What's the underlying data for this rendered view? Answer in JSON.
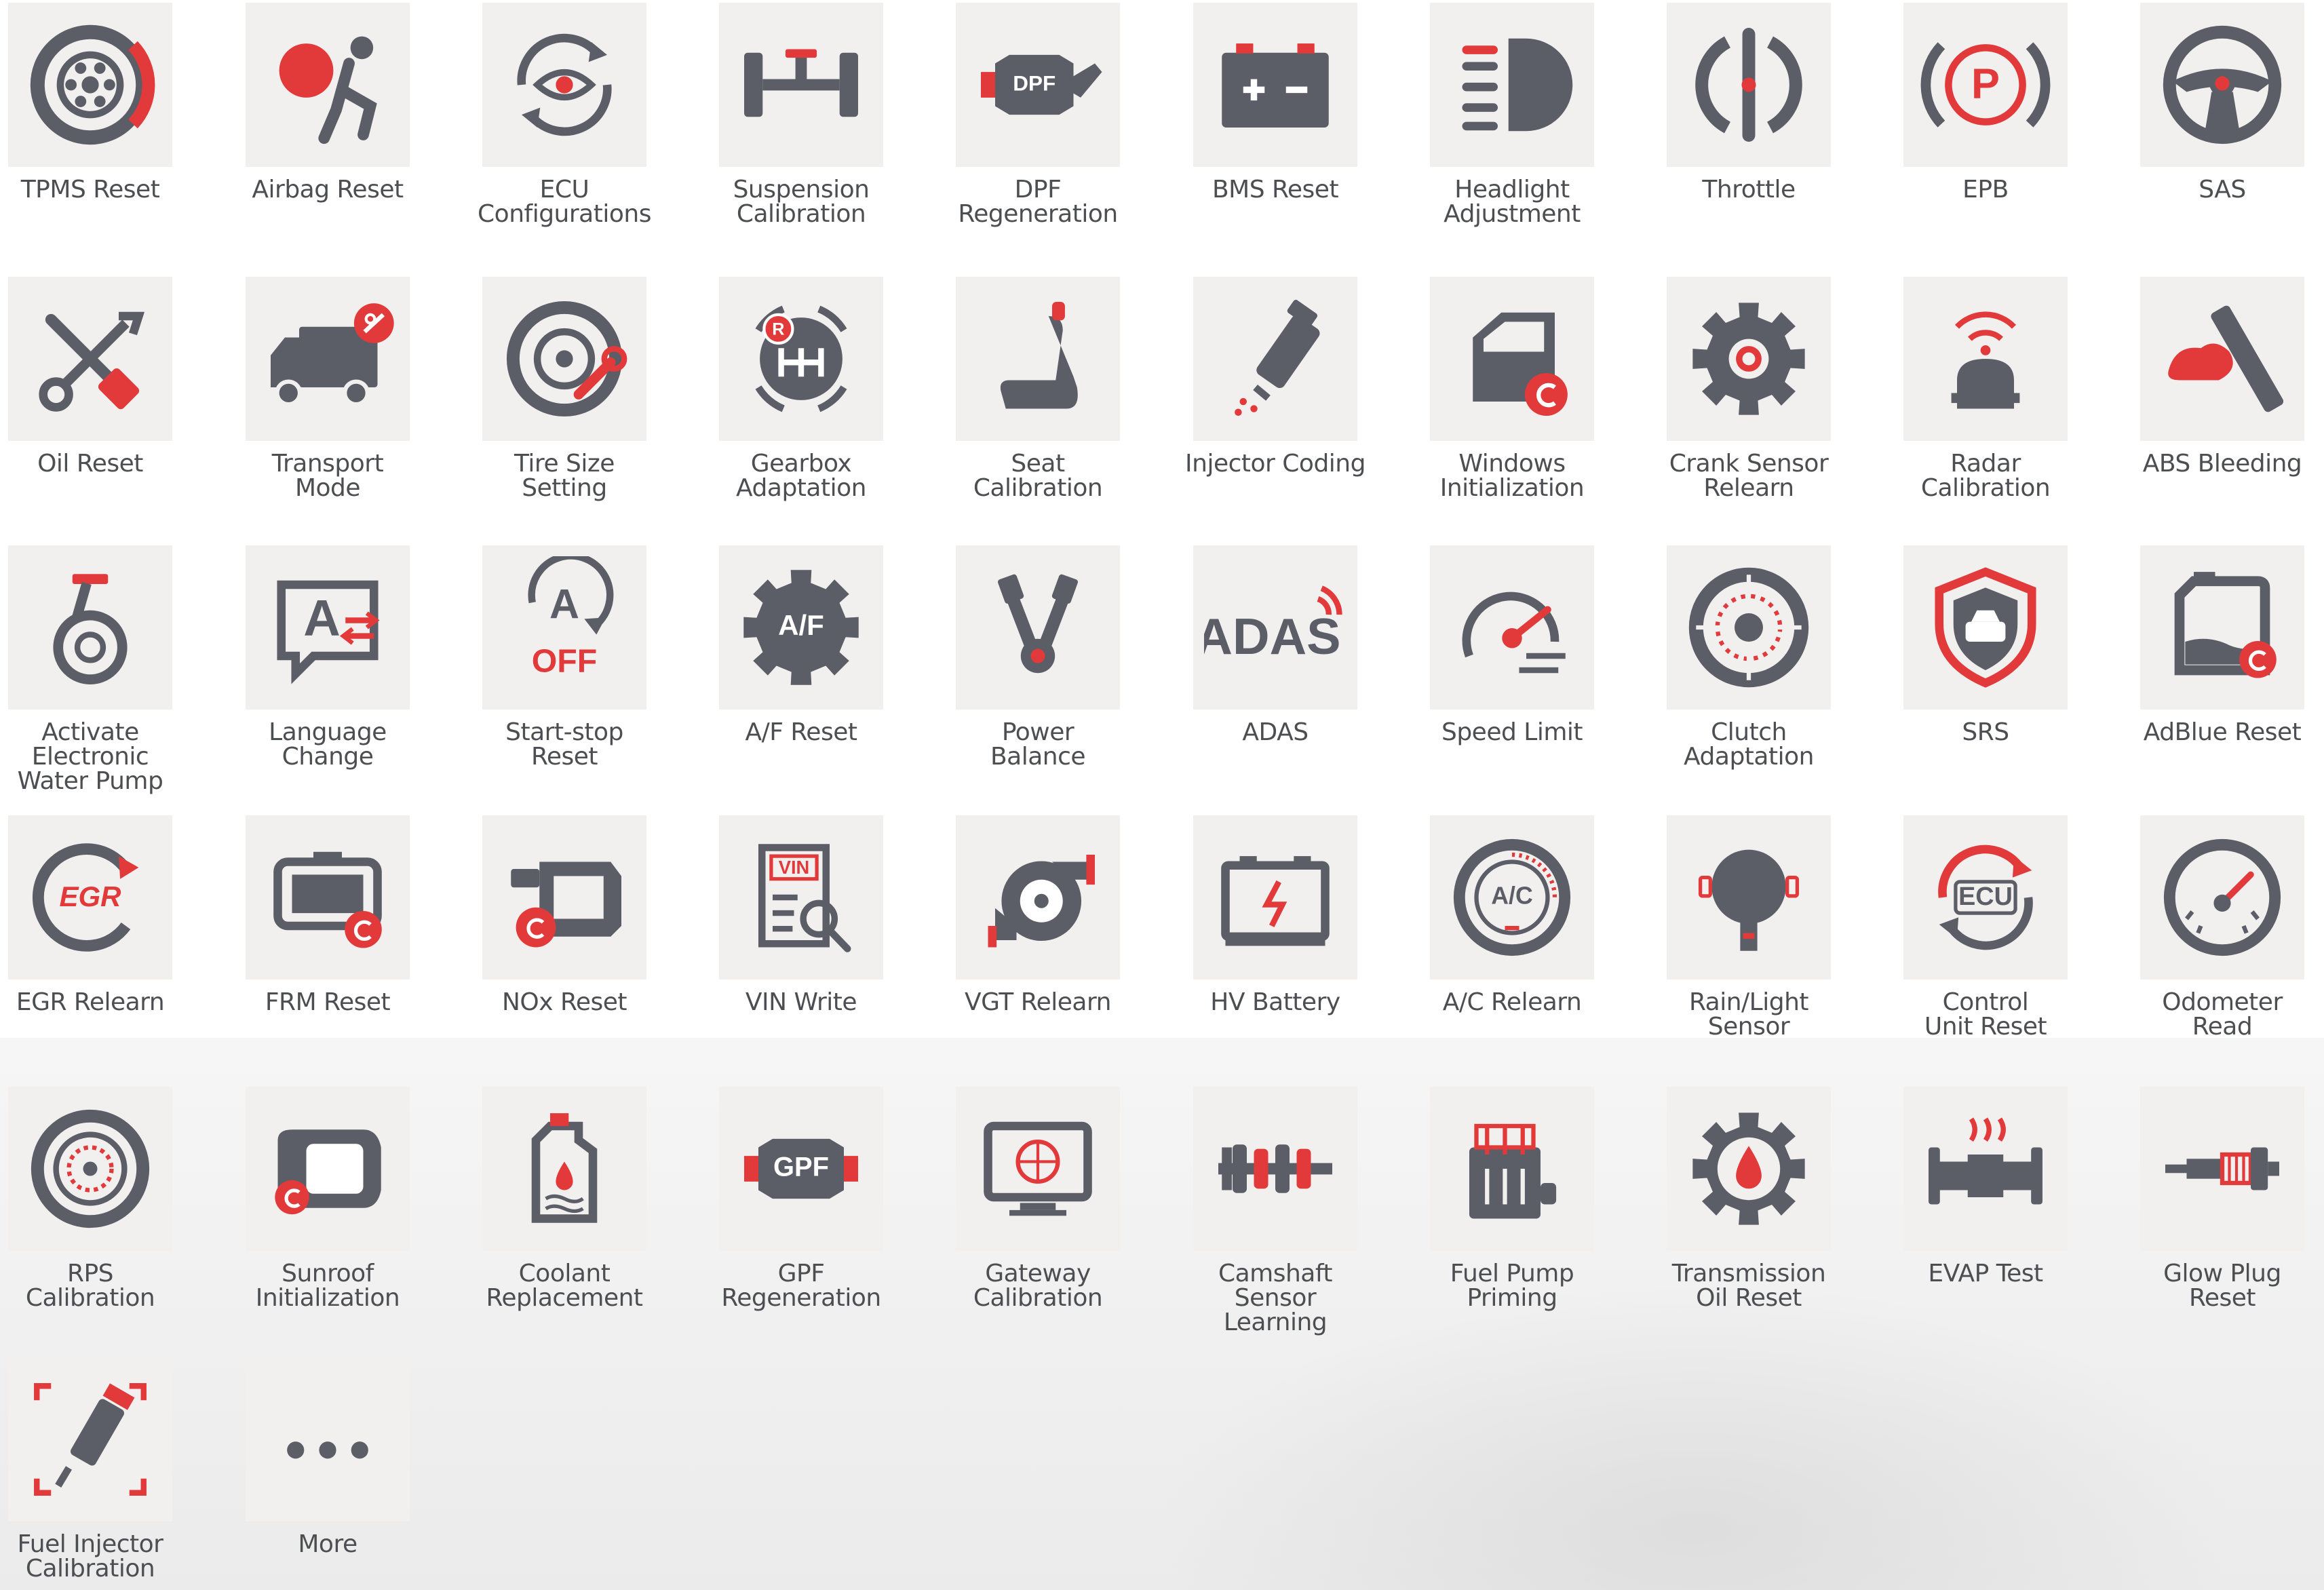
{
  "colors": {
    "icon_gray": "#5b5e66",
    "accent_red": "#e23a3a",
    "tile_bg": "#f2efef",
    "label": "#4d4e52"
  },
  "functions": [
    {
      "icon": "tire-icon",
      "label_lines": [
        "TPMS Reset"
      ]
    },
    {
      "icon": "airbag-icon",
      "label_lines": [
        "Airbag Reset"
      ]
    },
    {
      "icon": "ecu-eye-icon",
      "label_lines": [
        "ECU",
        "Configurations"
      ]
    },
    {
      "icon": "suspension-icon",
      "label_lines": [
        "Suspension",
        "Calibration"
      ]
    },
    {
      "icon": "dpf-icon",
      "label_lines": [
        "DPF",
        "Regeneration"
      ],
      "icon_text": "DPF"
    },
    {
      "icon": "battery-icon",
      "label_lines": [
        "BMS Reset"
      ]
    },
    {
      "icon": "headlight-icon",
      "label_lines": [
        "Headlight",
        "Adjustment"
      ]
    },
    {
      "icon": "throttle-icon",
      "label_lines": [
        "Throttle"
      ]
    },
    {
      "icon": "parking-brake-icon",
      "label_lines": [
        "EPB"
      ],
      "icon_text": "P"
    },
    {
      "icon": "steering-wheel-icon",
      "label_lines": [
        "SAS"
      ]
    },
    {
      "icon": "wrench-screwdriver-icon",
      "label_lines": [
        "Oil Reset"
      ]
    },
    {
      "icon": "truck-icon",
      "label_lines": [
        "Transport Mode"
      ]
    },
    {
      "icon": "tire-wrench-icon",
      "label_lines": [
        "Tire Size",
        "Setting"
      ]
    },
    {
      "icon": "gear-shift-icon",
      "label_lines": [
        "Gearbox",
        "Adaptation"
      ],
      "icon_text": "R"
    },
    {
      "icon": "seat-icon",
      "label_lines": [
        "Seat Calibration"
      ]
    },
    {
      "icon": "injector-icon",
      "label_lines": [
        "Injector Coding"
      ]
    },
    {
      "icon": "car-door-icon",
      "label_lines": [
        "Windows",
        "Initialization"
      ]
    },
    {
      "icon": "cog-icon",
      "label_lines": [
        "Crank Sensor",
        "Relearn"
      ]
    },
    {
      "icon": "radar-icon",
      "label_lines": [
        "Radar",
        "Calibration"
      ]
    },
    {
      "icon": "abs-bleeding-icon",
      "label_lines": [
        "ABS Bleeding"
      ]
    },
    {
      "icon": "water-pump-icon",
      "label_lines": [
        "Activate",
        "Electronic",
        "Water Pump"
      ]
    },
    {
      "icon": "language-icon",
      "label_lines": [
        "Language",
        "Change"
      ],
      "icon_text": "A"
    },
    {
      "icon": "start-stop-icon",
      "label_lines": [
        "Start-stop",
        "Reset"
      ],
      "icon_text": "A",
      "icon_text_2": "OFF"
    },
    {
      "icon": "af-gear-icon",
      "label_lines": [
        "A/F Reset"
      ],
      "icon_text": "A/F"
    },
    {
      "icon": "engine-v-icon",
      "label_lines": [
        "Power",
        "Balance"
      ]
    },
    {
      "icon": "adas-icon",
      "label_lines": [
        "ADAS"
      ],
      "icon_text": "ADAS"
    },
    {
      "icon": "speedometer-icon",
      "label_lines": [
        "Speed Limit"
      ]
    },
    {
      "icon": "clutch-icon",
      "label_lines": [
        "Clutch",
        "Adaptation"
      ]
    },
    {
      "icon": "shield-car-icon",
      "label_lines": [
        "SRS"
      ]
    },
    {
      "icon": "adblue-tank-icon",
      "label_lines": [
        "AdBlue Reset"
      ]
    },
    {
      "icon": "egr-icon",
      "label_lines": [
        "EGR Relearn"
      ],
      "icon_text": "EGR"
    },
    {
      "icon": "module-reset-icon",
      "label_lines": [
        "FRM Reset"
      ]
    },
    {
      "icon": "nox-sensor-icon",
      "label_lines": [
        "NOx Reset"
      ]
    },
    {
      "icon": "vin-document-icon",
      "label_lines": [
        "VIN Write"
      ],
      "icon_text": "VIN"
    },
    {
      "icon": "turbo-icon",
      "label_lines": [
        "VGT Relearn"
      ]
    },
    {
      "icon": "hv-battery-icon",
      "label_lines": [
        "HV Battery"
      ]
    },
    {
      "icon": "ac-dial-icon",
      "label_lines": [
        "A/C Relearn"
      ],
      "icon_text": "A/C"
    },
    {
      "icon": "rain-sensor-icon",
      "label_lines": [
        "Rain/Light",
        "Sensor"
      ]
    },
    {
      "icon": "ecu-reset-icon",
      "label_lines": [
        "Control",
        "Unit Reset"
      ],
      "icon_text": "ECU"
    },
    {
      "icon": "gauge-icon",
      "label_lines": [
        "Odometer",
        "Read"
      ]
    },
    {
      "icon": "brake-disc-icon",
      "label_lines": [
        "RPS",
        "Calibration"
      ]
    },
    {
      "icon": "sunroof-icon",
      "label_lines": [
        "Sunroof",
        "Initialization"
      ]
    },
    {
      "icon": "coolant-bottle-icon",
      "label_lines": [
        "Coolant",
        "Replacement"
      ]
    },
    {
      "icon": "gpf-icon",
      "label_lines": [
        "GPF",
        "Regeneration"
      ],
      "icon_text": "GPF"
    },
    {
      "icon": "gateway-monitor-icon",
      "label_lines": [
        "Gateway",
        "Calibration"
      ]
    },
    {
      "icon": "camshaft-icon",
      "label_lines": [
        "Camshaft",
        "Sensor",
        "Learning"
      ]
    },
    {
      "icon": "fuel-pump-icon",
      "label_lines": [
        "Fuel Pump",
        "Priming"
      ]
    },
    {
      "icon": "oil-drop-cog-icon",
      "label_lines": [
        "Transmission",
        "Oil Reset"
      ]
    },
    {
      "icon": "evap-pipe-icon",
      "label_lines": [
        "EVAP Test"
      ]
    },
    {
      "icon": "glow-plug-icon",
      "label_lines": [
        "Glow Plug",
        "Reset"
      ]
    },
    {
      "icon": "fuel-injector-scan-icon",
      "label_lines": [
        "Fuel Injector",
        "Calibration"
      ]
    },
    {
      "icon": "more-dots-icon",
      "label_lines": [
        "More"
      ]
    }
  ]
}
